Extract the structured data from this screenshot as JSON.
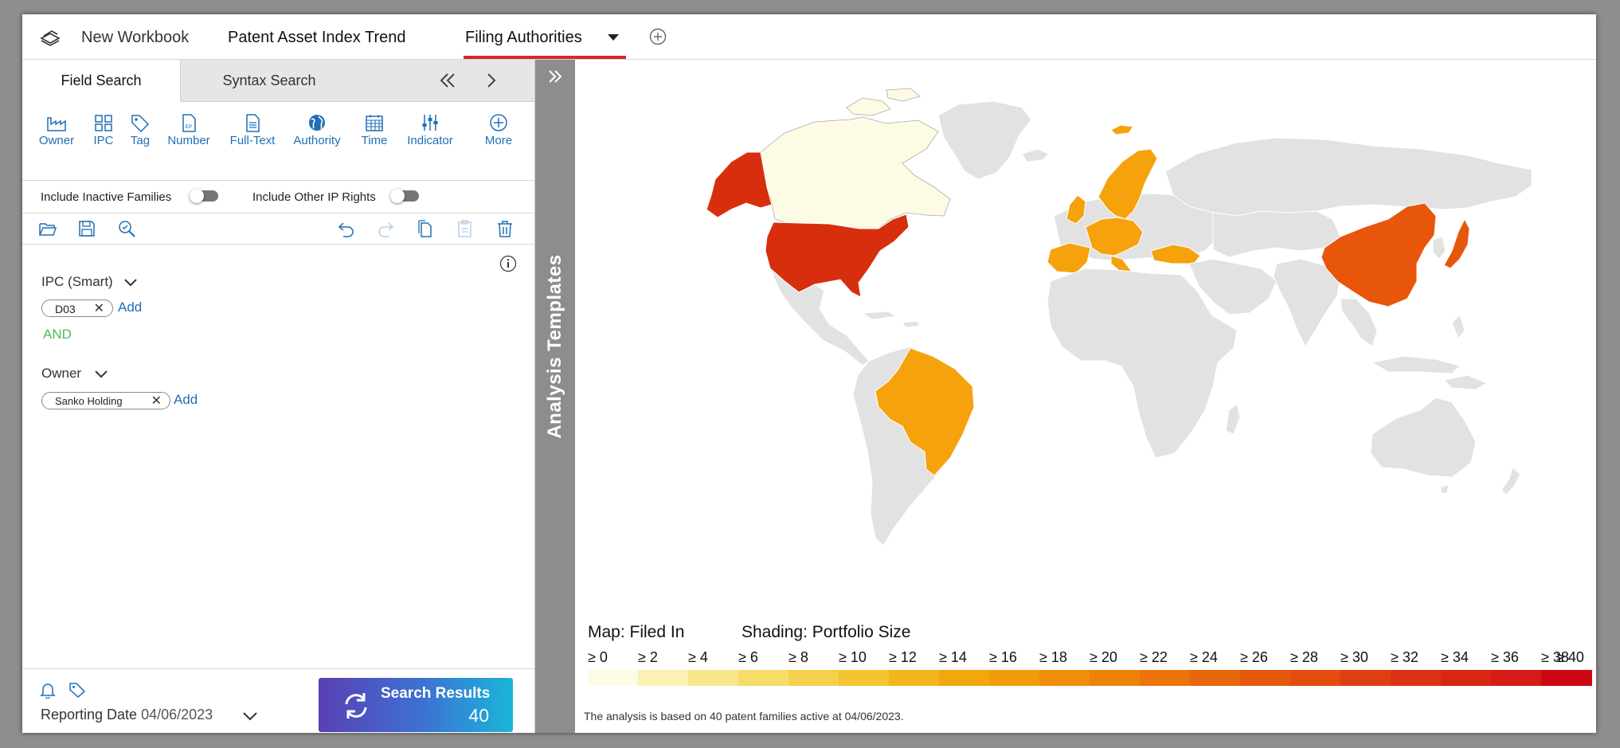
{
  "tabs": {
    "new_workbook": "New Workbook",
    "patent_trend": "Patent Asset Index Trend",
    "filing_authorities": "Filing Authorities"
  },
  "search_tabs": {
    "field": "Field Search",
    "syntax": "Syntax Search"
  },
  "fields": [
    "Owner",
    "IPC",
    "Tag",
    "Number",
    "Full-Text",
    "Authority",
    "Time",
    "Indicator",
    "More"
  ],
  "number_icon_text": "EP",
  "toggles": {
    "inactive": "Include Inactive Families",
    "other_ip": "Include Other IP Rights"
  },
  "criteria": {
    "ipc_label": "IPC (Smart)",
    "ipc_chip": "D03",
    "add": "Add",
    "and": "AND",
    "owner_label": "Owner",
    "owner_chip": "Sanko Holding"
  },
  "bottom": {
    "reporting_label": "Reporting Date",
    "reporting_date": "04/06/2023",
    "search_label": "Search Results",
    "search_count": "40"
  },
  "templates_label": "Analysis Templates",
  "legend": {
    "map_label": "Map: Filed In",
    "shading_label": "Shading: Portfolio Size",
    "ticks": [
      "≥ 0",
      "≥ 2",
      "≥ 4",
      "≥ 6",
      "≥ 8",
      "≥ 10",
      "≥ 12",
      "≥ 14",
      "≥ 16",
      "≥ 18",
      "≥ 20",
      "≥ 22",
      "≥ 24",
      "≥ 26",
      "≥ 28",
      "≥ 30",
      "≥ 32",
      "≥ 34",
      "≥ 36",
      "≥ 38",
      "≥ 40"
    ],
    "colors": [
      "#fdfbe3",
      "#fbf1b3",
      "#f9e68a",
      "#f8dc6a",
      "#f6d04c",
      "#f4c432",
      "#f3b51a",
      "#f2a70d",
      "#f19c0a",
      "#ef8f0a",
      "#ed820b",
      "#eb740b",
      "#e8660c",
      "#e5590d",
      "#e24c0e",
      "#de3f10",
      "#db3312",
      "#d72713",
      "#d31c15",
      "#cc0816"
    ]
  },
  "map_colors": {
    "land": "#e2e2e2",
    "border": "#ffffff",
    "lightest": "#fdfbe3",
    "low": "#f6a20d",
    "mid": "#eb7a10",
    "high": "#d72f0e"
  },
  "note": "The analysis is based on 40 patent families active at 04/06/2023."
}
